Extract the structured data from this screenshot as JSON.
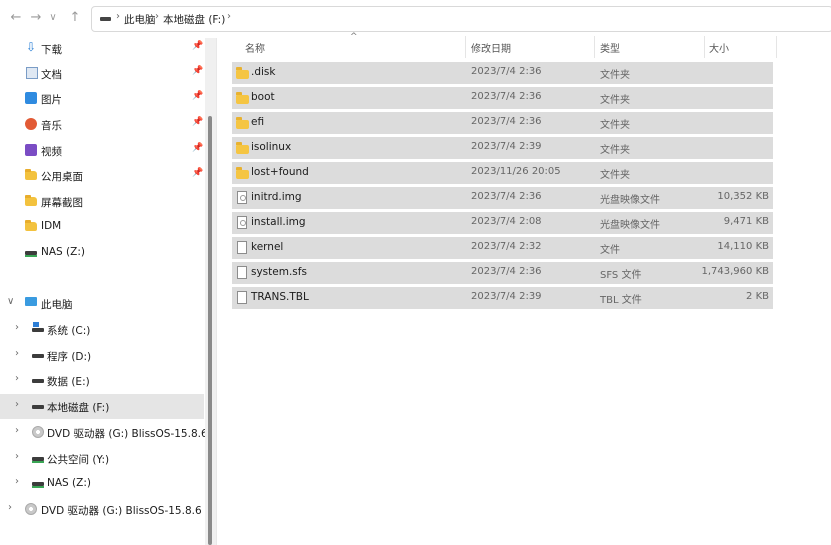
{
  "window": {
    "nav": {
      "back": "←",
      "forward": "→",
      "recent": "∨",
      "up": "↑"
    },
    "address": {
      "crumbs": [
        "此电脑",
        "本地磁盘 (F:)"
      ],
      "separator": "›"
    }
  },
  "sidebar": {
    "quick_access": [
      {
        "label": "下载",
        "icon": "download-icon",
        "pinned": true
      },
      {
        "label": "文档",
        "icon": "document-icon",
        "pinned": true
      },
      {
        "label": "图片",
        "icon": "picture-icon",
        "pinned": true
      },
      {
        "label": "音乐",
        "icon": "music-icon",
        "pinned": true
      },
      {
        "label": "视频",
        "icon": "video-icon",
        "pinned": true
      },
      {
        "label": "公用桌面",
        "icon": "folder-icon",
        "pinned": true
      },
      {
        "label": "屏幕截图",
        "icon": "folder-icon",
        "pinned": false
      },
      {
        "label": "IDM",
        "icon": "folder-icon",
        "pinned": false
      },
      {
        "label": "NAS (Z:)",
        "icon": "network-drive-icon",
        "pinned": false
      }
    ],
    "this_pc": {
      "label": "此电脑",
      "icon": "pc-icon"
    },
    "drives": [
      {
        "label": "系统 (C:)",
        "icon": "system-drive-icon"
      },
      {
        "label": "程序 (D:)",
        "icon": "drive-icon"
      },
      {
        "label": "数据 (E:)",
        "icon": "drive-icon"
      },
      {
        "label": "本地磁盘 (F:)",
        "icon": "drive-icon",
        "selected": true
      },
      {
        "label": "DVD 驱动器 (G:) BlissOS-15.8.6 (",
        "icon": "dvd-icon"
      },
      {
        "label": "公共空间 (Y:)",
        "icon": "network-drive-icon"
      },
      {
        "label": "NAS (Z:)",
        "icon": "network-drive-icon"
      }
    ],
    "extra": {
      "label": "DVD 驱动器 (G:) BlissOS-15.8.6 (",
      "icon": "dvd-icon"
    },
    "pin_glyph": "📌",
    "chevron_right": "›",
    "chevron_down": "∨"
  },
  "columns": {
    "name": "名称",
    "date": "修改日期",
    "type": "类型",
    "size": "大小",
    "sort_glyph": "^"
  },
  "files": [
    {
      "name": ".disk",
      "date": "2023/7/4 2:36",
      "type": "文件夹",
      "size": "",
      "icon": "folder"
    },
    {
      "name": "boot",
      "date": "2023/7/4 2:36",
      "type": "文件夹",
      "size": "",
      "icon": "folder"
    },
    {
      "name": "efi",
      "date": "2023/7/4 2:36",
      "type": "文件夹",
      "size": "",
      "icon": "folder"
    },
    {
      "name": "isolinux",
      "date": "2023/7/4 2:39",
      "type": "文件夹",
      "size": "",
      "icon": "folder"
    },
    {
      "name": "lost+found",
      "date": "2023/11/26 20:05",
      "type": "文件夹",
      "size": "",
      "icon": "folder"
    },
    {
      "name": "initrd.img",
      "date": "2023/7/4 2:36",
      "type": "光盘映像文件",
      "size": "10,352 KB",
      "icon": "disc"
    },
    {
      "name": "install.img",
      "date": "2023/7/4 2:08",
      "type": "光盘映像文件",
      "size": "9,471 KB",
      "icon": "disc"
    },
    {
      "name": "kernel",
      "date": "2023/7/4 2:32",
      "type": "文件",
      "size": "14,110 KB",
      "icon": "file"
    },
    {
      "name": "system.sfs",
      "date": "2023/7/4 2:36",
      "type": "SFS 文件",
      "size": "1,743,960 KB",
      "icon": "file"
    },
    {
      "name": "TRANS.TBL",
      "date": "2023/7/4 2:39",
      "type": "TBL 文件",
      "size": "2 KB",
      "icon": "file"
    }
  ]
}
